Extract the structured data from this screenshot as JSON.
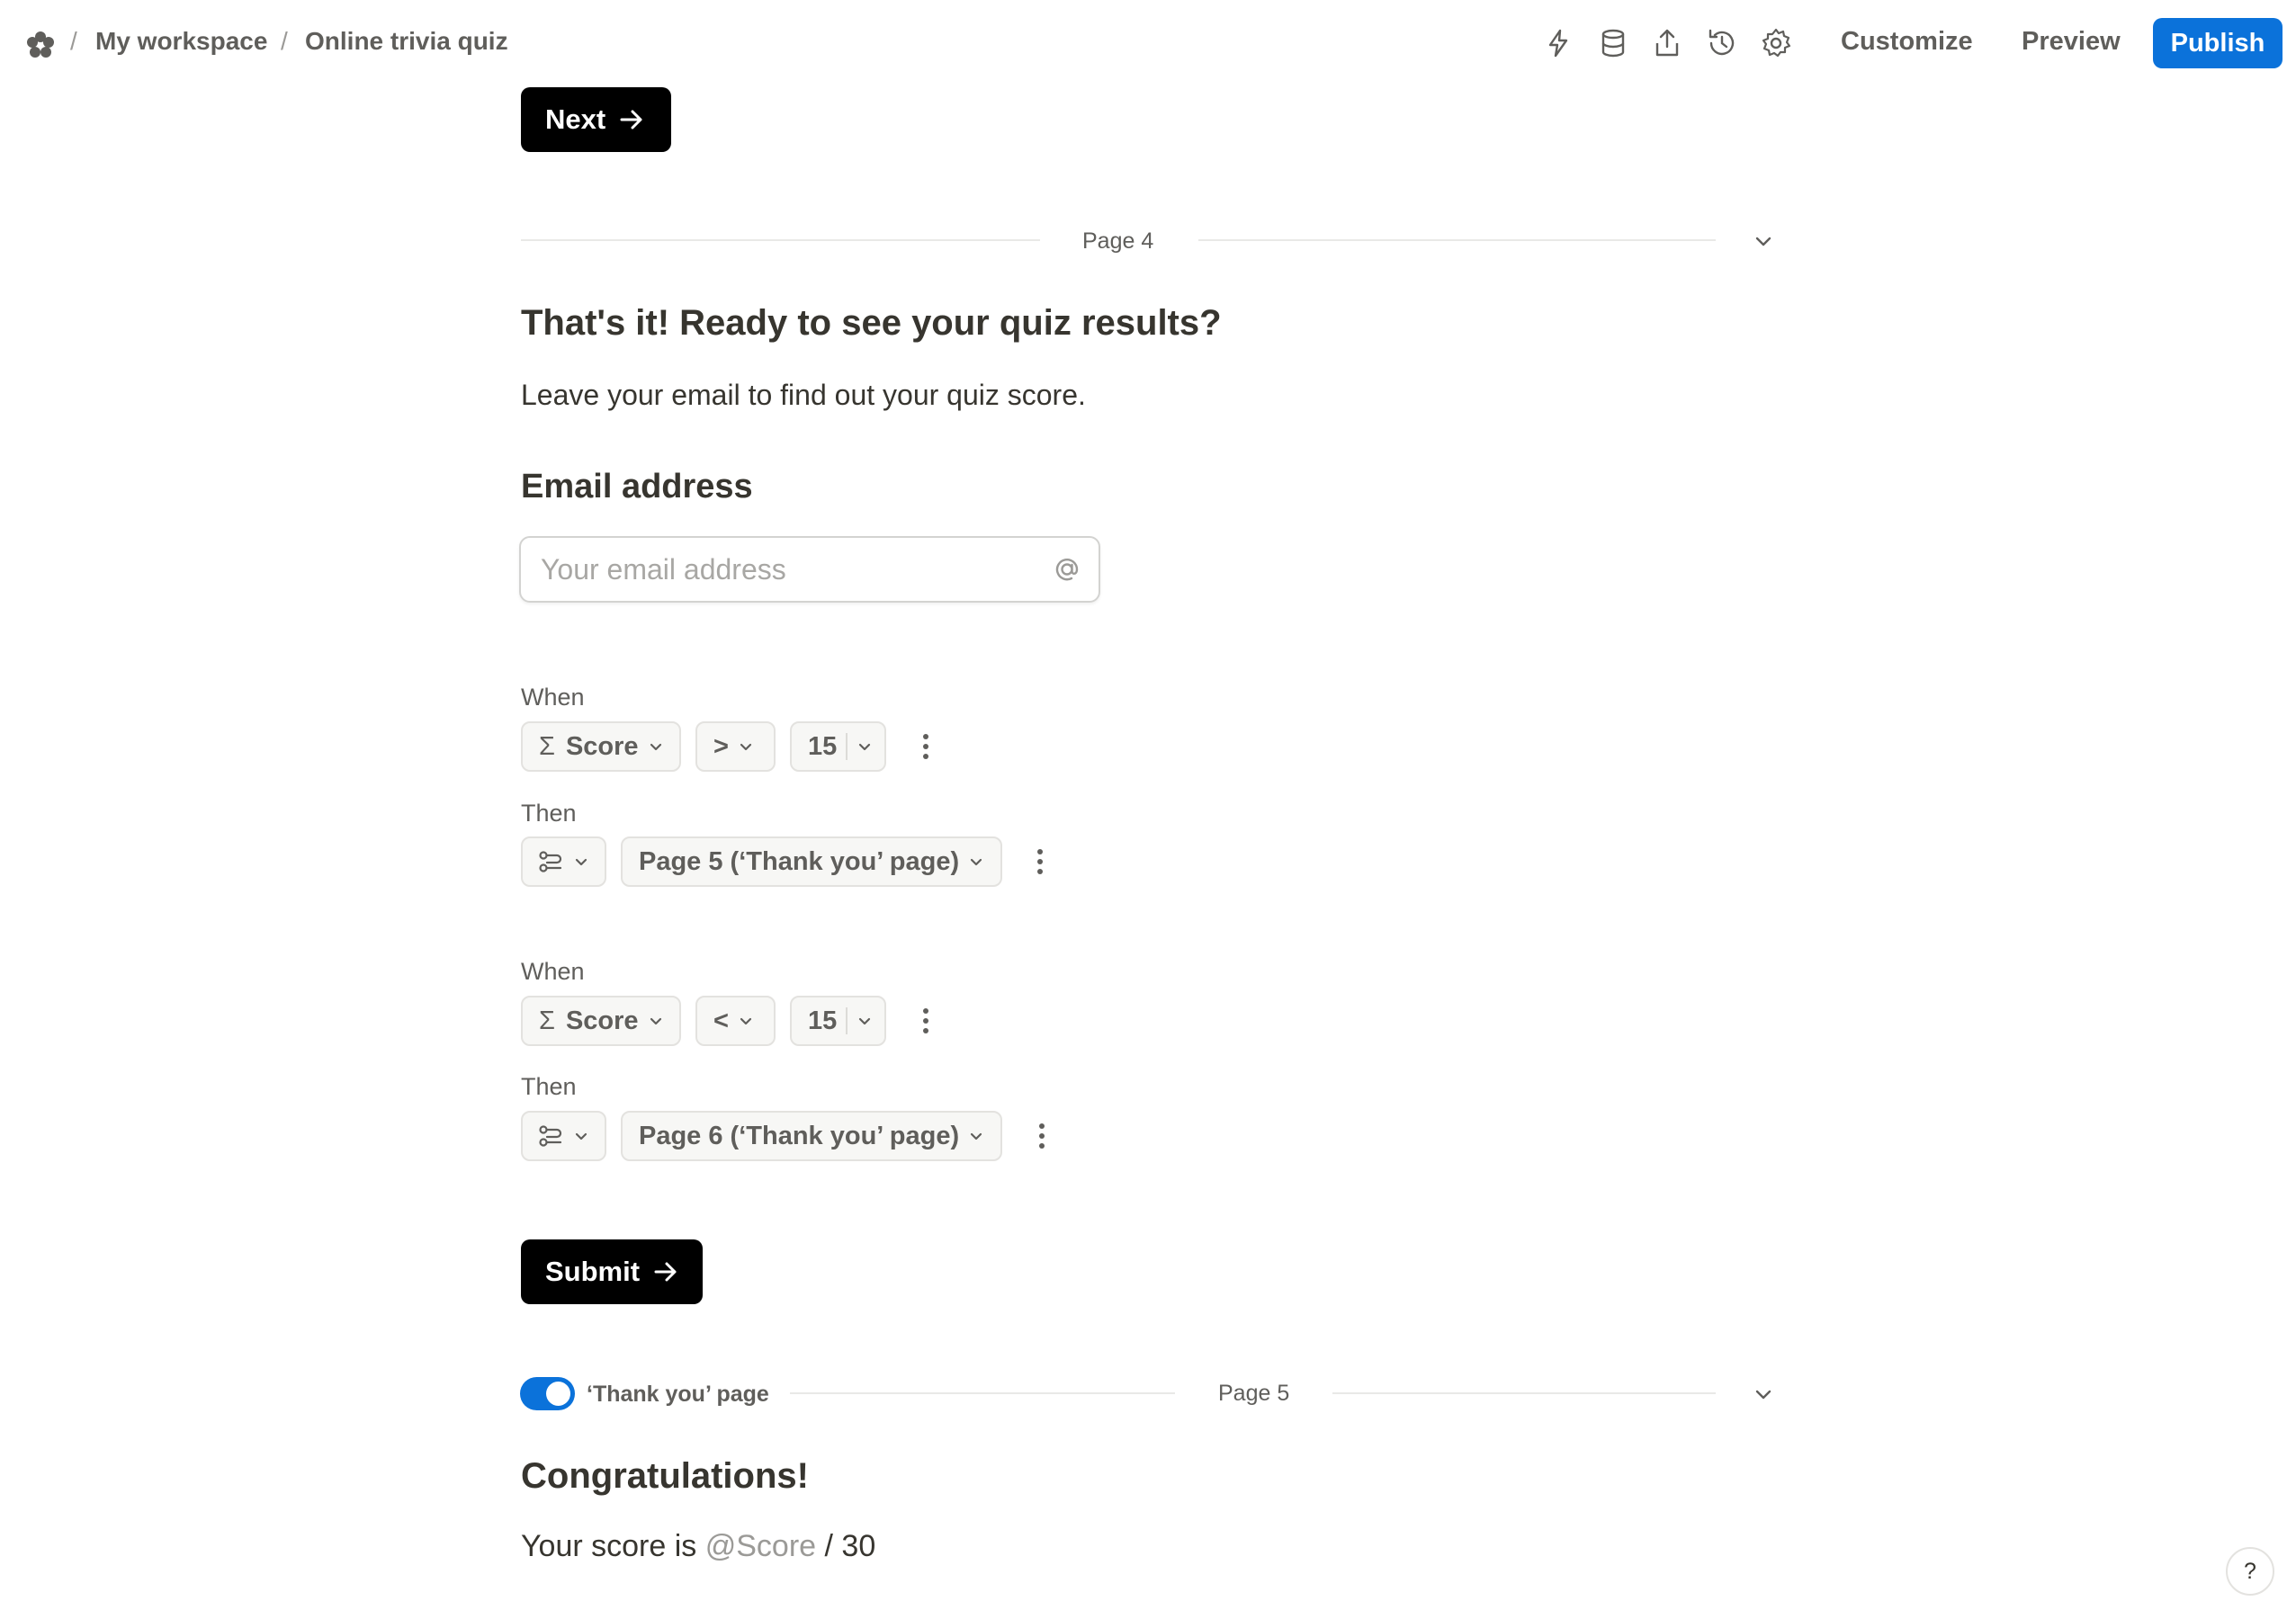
{
  "topbar": {
    "breadcrumb": [
      "My workspace",
      "Online trivia quiz"
    ],
    "separator": "/",
    "icons": [
      "lightning-icon",
      "database-icon",
      "share-icon",
      "history-icon",
      "gear-icon"
    ],
    "customize_label": "Customize",
    "preview_label": "Preview",
    "publish_label": "Publish"
  },
  "next_button": {
    "label": "Next"
  },
  "page4": {
    "page_label": "Page 4",
    "title": "That's it! Ready to see your quiz results?",
    "description": "Leave your email to find out your quiz score.",
    "email_question": "Email address",
    "email_placeholder": "Your email address",
    "email_value": ""
  },
  "logic": [
    {
      "when_label": "When",
      "field": "Score",
      "field_symbol": "Σ",
      "operator": ">",
      "value": "15",
      "then_label": "Then",
      "target": "Page 5 (‘Thank you’ page)"
    },
    {
      "when_label": "When",
      "field": "Score",
      "field_symbol": "Σ",
      "operator": "<",
      "value": "15",
      "then_label": "Then",
      "target": "Page 6 (‘Thank you’ page)"
    }
  ],
  "submit_button": {
    "label": "Submit"
  },
  "page5": {
    "thank_you_label": "‘Thank you’ page",
    "thank_you_enabled": true,
    "page_label": "Page 5",
    "title": "Congratulations!",
    "score_prefix": "Your score is ",
    "score_mention": "@Score",
    "score_suffix": " / 30"
  },
  "help": {
    "label": "?"
  },
  "colors": {
    "accent": "#0b72da",
    "button_dark": "#000000",
    "text": "#37352f",
    "muted": "#5f5e5b"
  }
}
